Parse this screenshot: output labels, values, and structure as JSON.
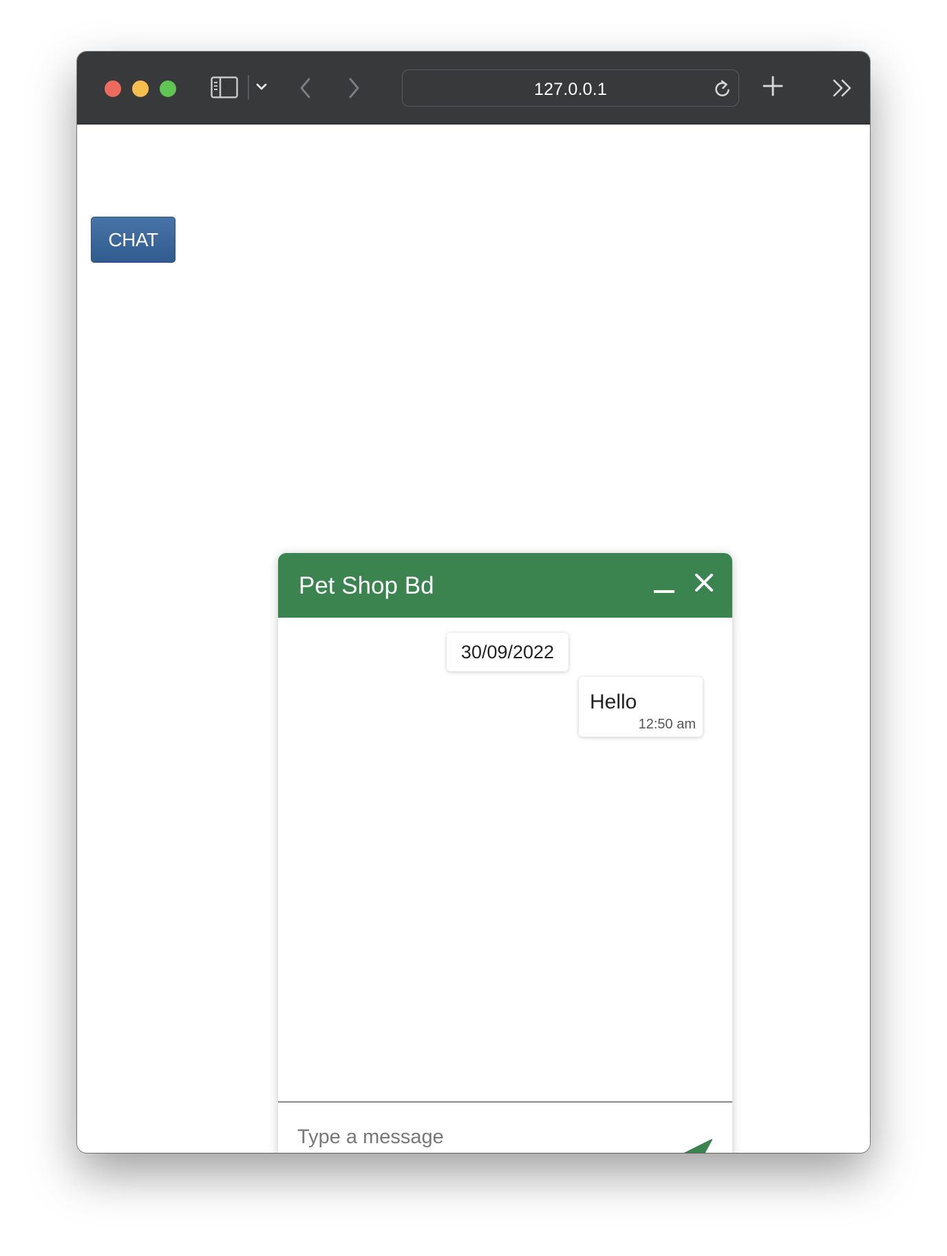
{
  "browser": {
    "address": "127.0.0.1",
    "icons": {
      "sidebar": "sidebar-icon",
      "dropdown": "chevron-down-icon",
      "back": "chevron-left-icon",
      "forward": "chevron-right-icon",
      "reload": "reload-icon",
      "new_tab": "plus-icon",
      "more": "double-chevron-right-icon"
    },
    "traffic_lights": [
      "#ec6a5e",
      "#f4bf4f",
      "#61c554"
    ]
  },
  "page": {
    "chat_button_label": "CHAT"
  },
  "chat": {
    "title": "Pet Shop Bd",
    "header_color": "#3b8450",
    "date_label": "30/09/2022",
    "messages": [
      {
        "text": "Hello",
        "time": "12:50 am"
      }
    ],
    "composer": {
      "placeholder": "Type a message",
      "value": ""
    },
    "icons": {
      "minimize": "minimize-icon",
      "close": "close-icon",
      "send": "send-icon"
    }
  }
}
